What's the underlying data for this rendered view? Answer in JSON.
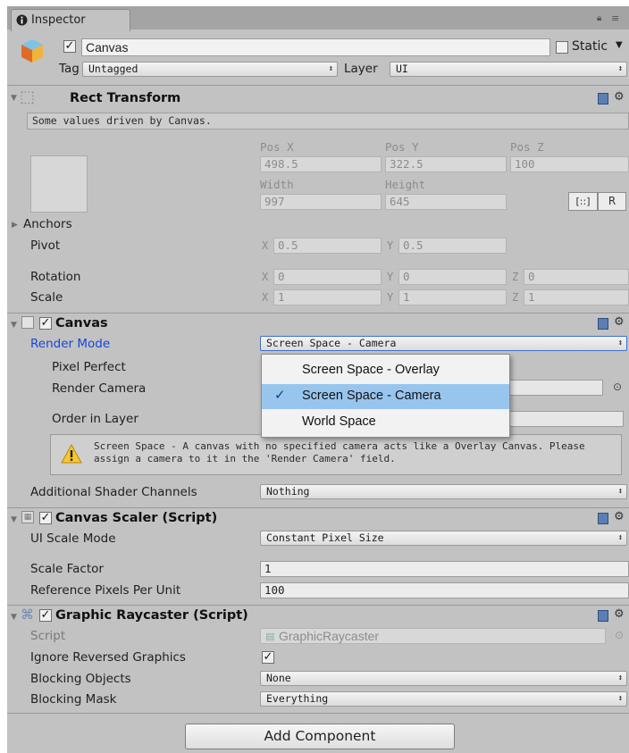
{
  "window": {
    "tab_title": "Inspector"
  },
  "gameobject": {
    "name": "Canvas",
    "static_label": "Static",
    "tag_label": "Tag",
    "tag_value": "Untagged",
    "layer_label": "Layer",
    "layer_value": "UI"
  },
  "rect_transform": {
    "title": "Rect Transform",
    "driven_note": "Some values driven by Canvas.",
    "pos_x_label": "Pos X",
    "pos_y_label": "Pos Y",
    "pos_z_label": "Pos Z",
    "pos_x": "498.5",
    "pos_y": "322.5",
    "pos_z": "100",
    "width_label": "Width",
    "height_label": "Height",
    "width": "997",
    "height": "645",
    "r_button": "R",
    "anchors_label": "Anchors",
    "pivot_label": "Pivot",
    "pivot_x": "0.5",
    "pivot_y": "0.5",
    "rotation_label": "Rotation",
    "rot_x": "0",
    "rot_y": "0",
    "rot_z": "0",
    "scale_label": "Scale",
    "scale_x": "1",
    "scale_y": "1",
    "scale_z": "1",
    "x_axis": "X",
    "y_axis": "Y",
    "z_axis": "Z"
  },
  "canvas": {
    "title": "Canvas",
    "render_mode_label": "Render Mode",
    "render_mode_value": "Screen Space - Camera",
    "pixel_perfect_label": "Pixel Perfect",
    "render_camera_label": "Render Camera",
    "order_in_layer_label": "Order in Layer",
    "warning_line1": "Screen Space - A canvas with no specified camera acts like a Overlay Canvas. Please",
    "warning_line2": "assign a camera to it in the 'Render Camera' field.",
    "shader_channels_label": "Additional Shader Channels",
    "shader_channels_value": "Nothing"
  },
  "render_mode_menu": {
    "options": [
      "Screen Space - Overlay",
      "Screen Space - Camera",
      "World Space"
    ],
    "selected": "Screen Space - Camera"
  },
  "canvas_scaler": {
    "title": "Canvas Scaler (Script)",
    "ui_scale_mode_label": "UI Scale Mode",
    "ui_scale_mode_value": "Constant Pixel Size",
    "scale_factor_label": "Scale Factor",
    "scale_factor_value": "1",
    "ref_ppu_label": "Reference Pixels Per Unit",
    "ref_ppu_value": "100"
  },
  "graphic_raycaster": {
    "title": "Graphic Raycaster (Script)",
    "script_label": "Script",
    "script_value": "GraphicRaycaster",
    "ignore_reversed_label": "Ignore Reversed Graphics",
    "blocking_objects_label": "Blocking Objects",
    "blocking_objects_value": "None",
    "blocking_mask_label": "Blocking Mask",
    "blocking_mask_value": "Everything"
  },
  "add_component_label": "Add Component",
  "colors": {
    "panel_bg": "#c2c2c2",
    "tabbar_bg": "#a4a4a4",
    "link_blue": "#1846d6",
    "menu_selected": "#98c5ee"
  }
}
